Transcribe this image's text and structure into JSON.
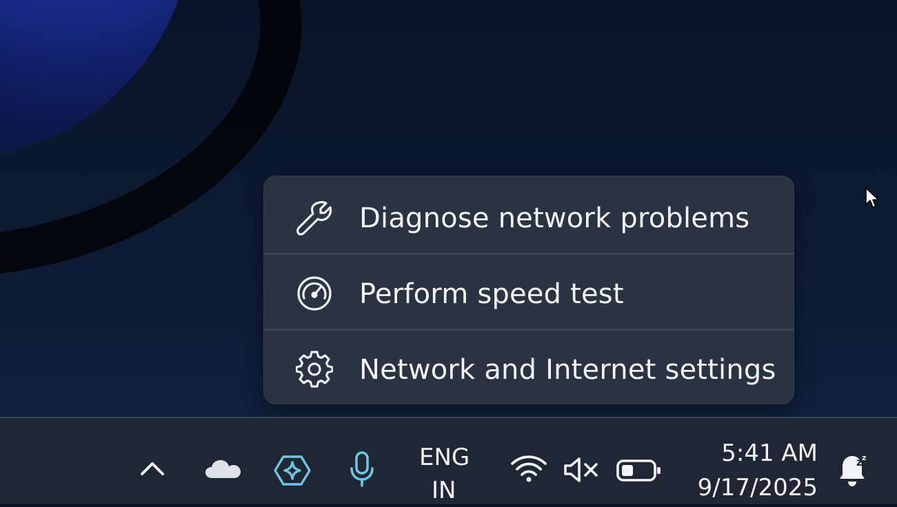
{
  "menu": {
    "items": [
      {
        "label": "Diagnose network problems",
        "icon": "wrench-icon"
      },
      {
        "label": "Perform speed test",
        "icon": "speedometer-icon"
      },
      {
        "label": "Network and Internet settings",
        "icon": "gear-icon"
      }
    ]
  },
  "taskbar": {
    "language": {
      "line1": "ENG",
      "line2": "IN"
    },
    "clock": {
      "time": "5:41 AM",
      "date": "9/17/2025"
    },
    "icons": [
      "chevron-up-icon",
      "onedrive-cloud-icon",
      "copilot-icon",
      "microphone-icon",
      "wifi-icon",
      "volume-muted-icon",
      "battery-icon",
      "notification-bell-snooze-icon"
    ]
  },
  "colors": {
    "menu_bg": "#2a3342",
    "taskbar_bg": "#1f2734",
    "accent_teal": "#6fc6e2",
    "text": "#f2f4f7"
  }
}
